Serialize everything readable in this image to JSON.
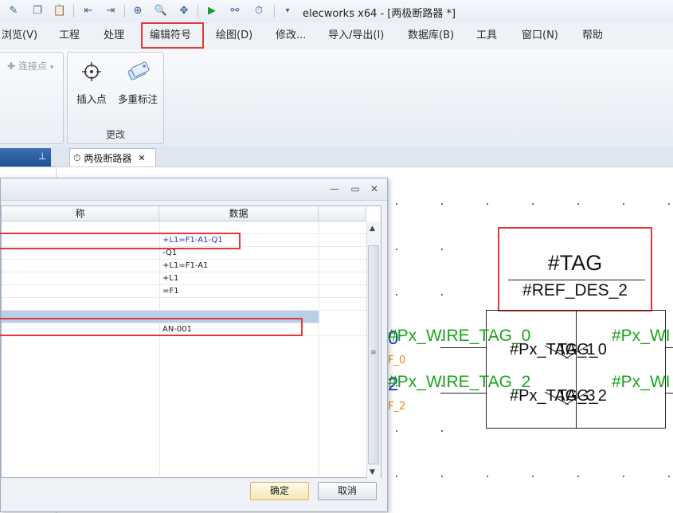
{
  "window": {
    "title": "elecworks x64 - [两极断路器 *]"
  },
  "menu": {
    "items": [
      "浏览(V)",
      "工程",
      "处理",
      "编辑符号",
      "绘图(D)",
      "修改...",
      "导入/导出(I)",
      "数据库(B)",
      "工具",
      "窗口(N)",
      "帮助"
    ]
  },
  "ribbon": {
    "connect_point_label": "连接点",
    "insert_point_label": "插入点",
    "multi_tag_label": "多重标注",
    "group_label": "更改"
  },
  "tabs": {
    "document_tab": "两极断路器"
  },
  "dialog": {
    "col_name": "称",
    "col_data": "数据",
    "rows": [
      {
        "data": ""
      },
      {
        "data": "+L1=F1-A1-Q1"
      },
      {
        "data": "-Q1"
      },
      {
        "data": "+L1=F1-A1"
      },
      {
        "data": "+L1"
      },
      {
        "data": "=F1"
      },
      {
        "data": ""
      },
      {
        "data": ""
      },
      {
        "data": "AN-001"
      }
    ],
    "ok_label": "确定",
    "cancel_label": "取消"
  },
  "canvas": {
    "tag": "#TAG",
    "ref_des": "#REF_DES_2",
    "wire_tag_0": "#Px_WIRE_TAG_0",
    "wire_tag_2": "#Px_WIRE_TAG_2",
    "wire_right_0": "#Px_WI",
    "wire_right_2": "#Px_WI",
    "num_0": "0",
    "num_2": "2",
    "f_0": "F_0",
    "f_2": "F_2",
    "pin_tag_1": "#Px_TAG_1",
    "pin_tag_3": "#Px_TAG_3",
    "pin_overlap_a": "TAG_0",
    "pin_overlap_b": "TAG_2"
  },
  "colors": {
    "highlight": "#e3373a",
    "wire_green": "#1aa51a",
    "selection": "#b8cfea"
  }
}
